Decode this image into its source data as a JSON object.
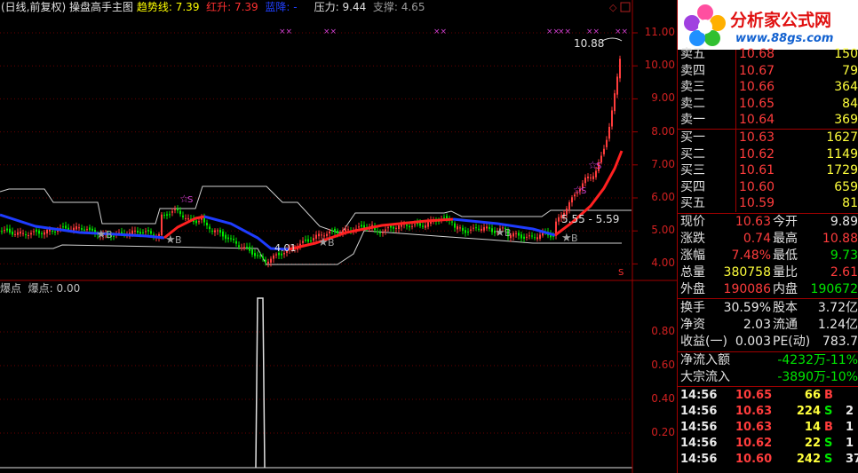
{
  "header": {
    "period": "(日线,前复权)",
    "indicator": "操盘高手主图",
    "trend_label": "趋势线:",
    "trend_value": "7.39",
    "red_label": "红升:",
    "red_value": "7.39",
    "blue_label": "蓝降:",
    "blue_value": "-",
    "pressure_label": "压力:",
    "pressure_value": "9.44",
    "support_label": "支撑:",
    "support_value": "4.65"
  },
  "sub_header": {
    "name": "爆点",
    "label": "爆点:",
    "value": "0.00"
  },
  "price_axis": [
    "11.00",
    "10.00",
    "9.00",
    "8.00",
    "7.00",
    "6.00",
    "5.00",
    "4.00"
  ],
  "sub_axis": [
    "0.80",
    "0.60",
    "0.40",
    "0.20"
  ],
  "annotations": {
    "high": "10.88",
    "low": "4.01",
    "range": "5.55 - 5.59",
    "buy": "B",
    "sell": "S",
    "s_mark": "S"
  },
  "logo": {
    "title": "分析家公式网",
    "url": "www.88gs.com"
  },
  "orderbook": {
    "asks": [
      {
        "label": "卖五",
        "price": "10.68",
        "vol": "150"
      },
      {
        "label": "卖四",
        "price": "10.67",
        "vol": "79"
      },
      {
        "label": "卖三",
        "price": "10.66",
        "vol": "364"
      },
      {
        "label": "卖二",
        "price": "10.65",
        "vol": "84"
      },
      {
        "label": "卖一",
        "price": "10.64",
        "vol": "369"
      }
    ],
    "bids": [
      {
        "label": "买一",
        "price": "10.63",
        "vol": "1627"
      },
      {
        "label": "买二",
        "price": "10.62",
        "vol": "1149"
      },
      {
        "label": "买三",
        "price": "10.61",
        "vol": "1729"
      },
      {
        "label": "买四",
        "price": "10.60",
        "vol": "659"
      },
      {
        "label": "买五",
        "price": "10.59",
        "vol": "81"
      }
    ]
  },
  "quote": [
    {
      "l1": "现价",
      "v1": "10.63",
      "c1": "red",
      "l2": "今开",
      "v2": "9.89",
      "c2": "wht"
    },
    {
      "l1": "涨跌",
      "v1": "0.74",
      "c1": "red",
      "l2": "最高",
      "v2": "10.88",
      "c2": "red"
    },
    {
      "l1": "涨幅",
      "v1": "7.48%",
      "c1": "red",
      "l2": "最低",
      "v2": "9.73",
      "c2": "grn"
    },
    {
      "l1": "总量",
      "v1": "380758",
      "c1": "yel",
      "l2": "量比",
      "v2": "2.61",
      "c2": "red"
    },
    {
      "l1": "外盘",
      "v1": "190086",
      "c1": "red",
      "l2": "内盘",
      "v2": "190672",
      "c2": "grn"
    }
  ],
  "fundamentals": [
    {
      "l1": "换手",
      "v1": "30.59%",
      "l2": "股本",
      "v2": "3.72亿"
    },
    {
      "l1": "净资",
      "v1": "2.03",
      "l2": "流通",
      "v2": "1.24亿"
    },
    {
      "l1": "收益(一)",
      "v1": "0.003",
      "l2": "PE(动)",
      "v2": "783.7"
    }
  ],
  "flows": [
    {
      "label": "净流入额",
      "v1": "-4232万",
      "v2": "-11%"
    },
    {
      "label": "大宗流入",
      "v1": "-3890万",
      "v2": "-10%"
    }
  ],
  "ticks": [
    {
      "time": "14:56",
      "price": "10.65",
      "vol": "66",
      "side": "B",
      "extra": ""
    },
    {
      "time": "14:56",
      "price": "10.63",
      "vol": "224",
      "side": "S",
      "extra": "2"
    },
    {
      "time": "14:56",
      "price": "10.63",
      "vol": "14",
      "side": "B",
      "extra": "1"
    },
    {
      "time": "14:56",
      "price": "10.62",
      "vol": "22",
      "side": "S",
      "extra": "1"
    },
    {
      "time": "14:56",
      "price": "10.60",
      "vol": "242",
      "side": "S",
      "extra": "37"
    }
  ],
  "colors": {
    "up": "#ff3c3c",
    "down": "#00e600",
    "trend_down": "#1e3cff",
    "grid": "#a00000"
  }
}
